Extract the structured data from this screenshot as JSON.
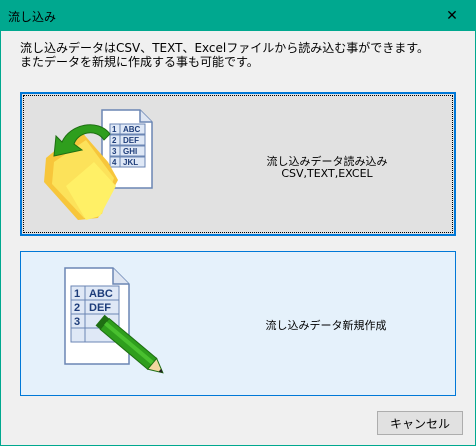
{
  "window": {
    "title": "流し込み",
    "close_symbol": "✕"
  },
  "description": {
    "line1": "流し込みデータはCSV、TEXT、Excelファイルから読み込む事ができます。",
    "line2": "またデータを新規に作成する事も可能です。"
  },
  "import_button": {
    "line1": "流し込みデータ読み込み",
    "line2": "CSV,TEXT,EXCEL",
    "icon": "folder-import-icon",
    "rows": [
      {
        "num": "1",
        "text": "ABC"
      },
      {
        "num": "2",
        "text": "DEF"
      },
      {
        "num": "3",
        "text": "GHI"
      },
      {
        "num": "4",
        "text": "JKL"
      }
    ]
  },
  "new_button": {
    "label": "流し込みデータ新規作成",
    "icon": "document-pencil-icon",
    "rows": [
      {
        "num": "1",
        "text": "ABC"
      },
      {
        "num": "2",
        "text": "DEF"
      },
      {
        "num": "3",
        "text": ""
      }
    ]
  },
  "cancel_button": {
    "label": "キャンセル"
  },
  "colors": {
    "titlebar": "#00a88f",
    "accent_border": "#0078d7",
    "import_bg": "#e1e1e1",
    "new_bg": "#e5f1fb"
  }
}
